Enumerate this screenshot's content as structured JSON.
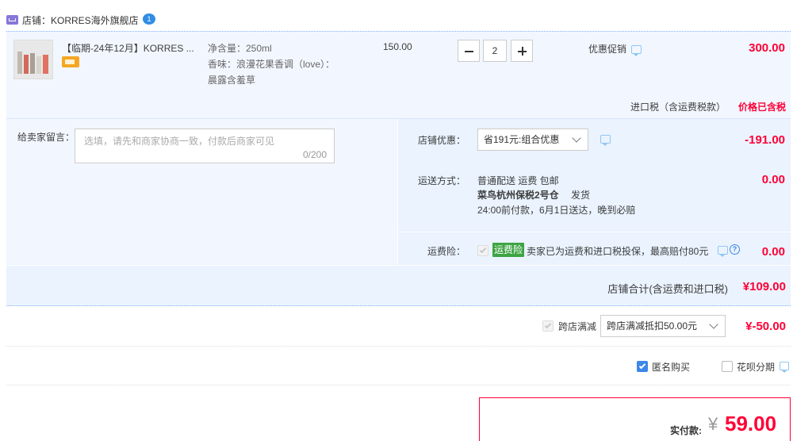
{
  "shop": {
    "label": "店铺：",
    "name": "KORRES海外旗舰店",
    "badge": "1"
  },
  "item": {
    "title": "【临期-24年12月】KORRES ...",
    "sku_volume": "净含量：250ml",
    "sku_scent_line1": "香味：浪漫花果香调（love）：",
    "sku_scent_line2": "晨露含羞草",
    "price": "150.00",
    "quantity": "2",
    "promo_label": "优惠促销",
    "subtotal": "300.00",
    "tax_label": "进口税（含运费税款）",
    "tax_value": "价格已含税"
  },
  "message": {
    "label": "给卖家留言：",
    "placeholder": "选填，请先和商家协商一致，付款后商家可见",
    "counter": "0/200"
  },
  "discount": {
    "label": "店铺优惠：",
    "select_value": "省191元:组合优惠",
    "amount": "-191.00"
  },
  "shipping": {
    "label": "运送方式：",
    "line1": "普通配送 运费 包邮",
    "line2": "菜鸟杭州保税2号仓",
    "line2_suffix": "发货",
    "line3": "24:00前付款，6月1日送达，晚到必赔",
    "amount": "0.00"
  },
  "insurance": {
    "label": "运费险：",
    "tag": "运费险",
    "desc": "卖家已为运费和进口税投保，最高赔付80元",
    "amount": "0.00"
  },
  "shop_total": {
    "label": "店铺合计(含运费和进口税)",
    "amount": "¥109.00"
  },
  "cross_discount": {
    "label": "跨店满减",
    "select_value": "跨店满减抵扣50.00元",
    "amount": "¥-50.00"
  },
  "options": {
    "anonymous": "匿名购买",
    "huabei": "花呗分期"
  },
  "payment": {
    "label": "实付款:",
    "currency": "¥",
    "amount": "59.00"
  },
  "colors": {
    "accent_red": "#ff0036",
    "row_blue": "#eaf3fe",
    "checkbox_blue": "#3d86ea",
    "tag_green": "#3ea444"
  },
  "icons": [
    "shop-icon",
    "wangwang-chat-icon",
    "product-thumbnail",
    "card-badge-icon",
    "minus-icon",
    "plus-icon",
    "chevron-down-icon",
    "checkbox-icon",
    "help-icon"
  ]
}
